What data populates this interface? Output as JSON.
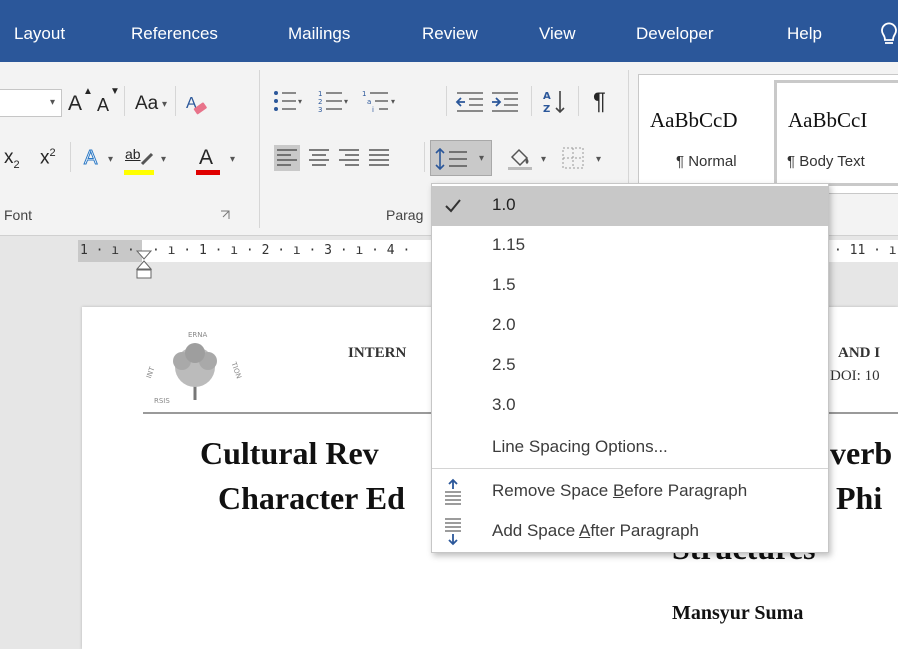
{
  "ribbon_tabs": [
    "Layout",
    "References",
    "Mailings",
    "Review",
    "View",
    "Developer",
    "Help"
  ],
  "font_group": {
    "label": "Font",
    "grow_font": "A",
    "shrink_font": "A",
    "change_case": "Aa",
    "subscript": "x",
    "subscript_mark": "2",
    "superscript": "x",
    "superscript_mark": "2",
    "font_color_letter": "A",
    "highlight_letters": "ab",
    "highlight_color": "#ffff00",
    "font_color": "#e00000"
  },
  "paragraph_group": {
    "label": "Parag",
    "show_marks": "¶"
  },
  "styles_gallery": {
    "items": [
      {
        "sample": "AaBbCcD",
        "name": "¶ Normal"
      },
      {
        "sample": "AaBbCcI",
        "name": "¶ Body Text"
      }
    ]
  },
  "ruler": {
    "left_text": "1 · ı · ",
    "mid_text": "· ı · 1 · ı · 2 · ı · 3 · ı · 4 ·",
    "right_text": "· 11 · ı"
  },
  "line_spacing_menu": {
    "selected": "1.0",
    "options": [
      "1.0",
      "1.15",
      "1.5",
      "2.0",
      "2.5",
      "3.0"
    ],
    "options_link": "Line Spacing Options...",
    "remove_before_pre": "Remove Space ",
    "remove_before_key": "B",
    "remove_before_post": "efore Paragraph",
    "add_after_pre": "Add Space ",
    "add_after_key": "A",
    "add_after_post": "fter Paragraph"
  },
  "document": {
    "header_left": "INTERN",
    "header_right_1": "AND I",
    "header_right_2": "DOI: 10",
    "title_line1_left": "Cultural Rev",
    "title_line1_right": "verb",
    "title_line2_left": "Character Ed",
    "title_line2_right": "Phi",
    "title_line3": "Structures",
    "author": "Mansyur Suma",
    "logo_text": "RSIS INTERNATIONAL"
  }
}
